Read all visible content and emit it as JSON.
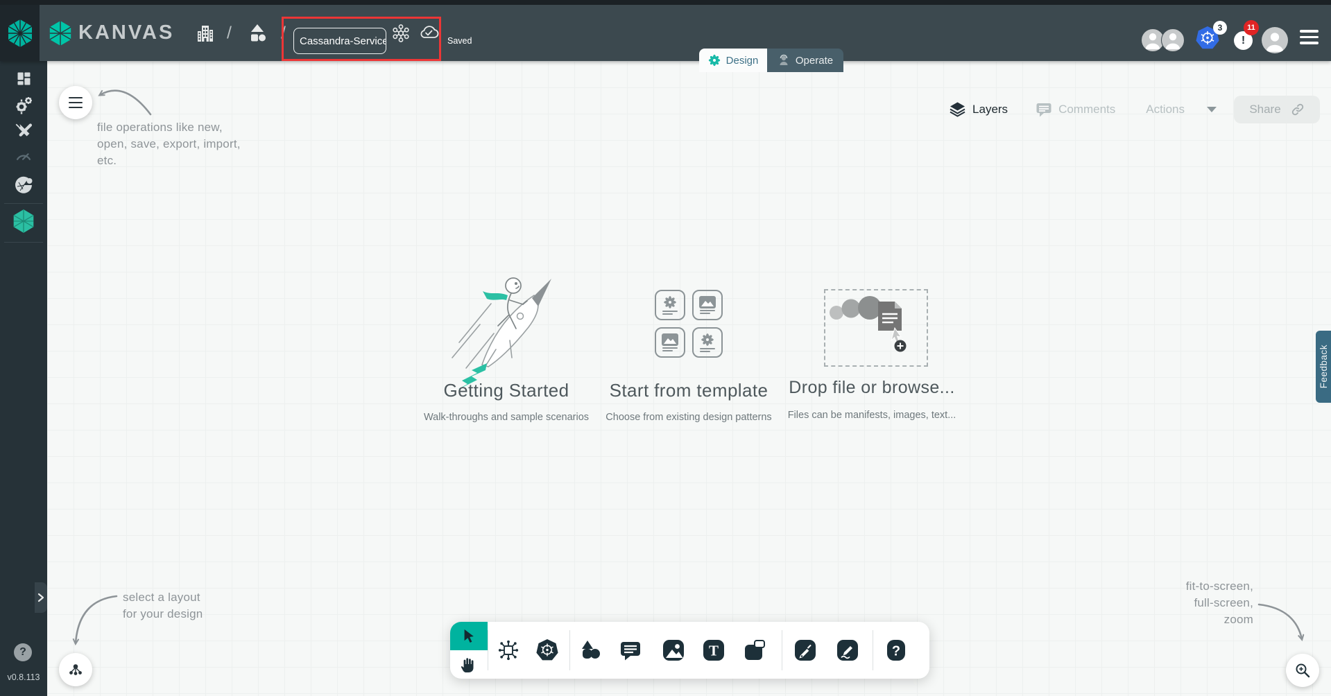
{
  "app": {
    "version": "v0.8.113"
  },
  "colors": {
    "accent_teal": "#00B39F",
    "header_bg": "#3C494F",
    "sidebar_bg": "#263238",
    "canvas_bg": "#F6F8F7",
    "highlight_red": "#EC3636",
    "kubernetes_blue": "#326CE5",
    "alert_badge_red": "#E02424",
    "feedback_bg": "#3A6B83",
    "toolbar_icon": "#1D3039"
  },
  "header": {
    "brand": "KANVAS",
    "separator": "/",
    "design_name_value": "Cassandra-Service",
    "saved_status": "Saved",
    "kubernetes_badge": "3",
    "notification_badge": "11",
    "alert_glyph": "!"
  },
  "tabs": {
    "design_label": "Design",
    "operate_label": "Operate"
  },
  "canvas_header": {
    "layers_label": "Layers",
    "comments_label": "Comments",
    "actions_label": "Actions",
    "share_label": "Share"
  },
  "cards": {
    "getting_started": {
      "title": "Getting Started",
      "subtitle": "Walk-throughs and sample scenarios"
    },
    "start_from_template": {
      "title": "Start from template",
      "subtitle": "Choose from existing design patterns"
    },
    "drop_file": {
      "title": "Drop file or browse...",
      "subtitle": "Files can be manifests, images, text..."
    }
  },
  "annotations": {
    "file_operations": [
      "file operations like new,",
      "open, save, export, import,",
      "etc."
    ],
    "layout": [
      "select a layout",
      "for your design"
    ],
    "zoom_controls": [
      "fit-to-screen,",
      "full-screen,",
      "zoom"
    ]
  },
  "sidebar": {
    "help_glyph": "?"
  },
  "toolbar": {
    "text_tool_glyph": "T",
    "help_glyph": "?"
  },
  "feedback_label": "Feedback"
}
